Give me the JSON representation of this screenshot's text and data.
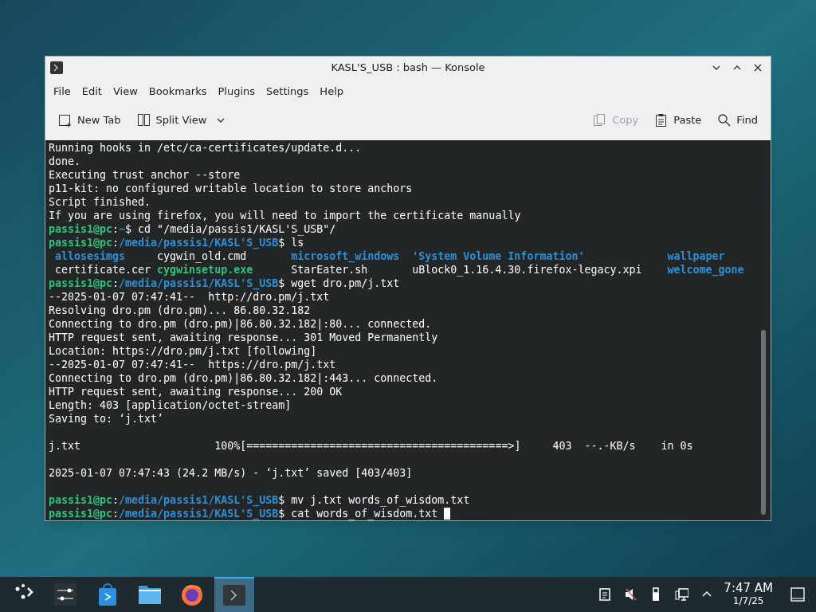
{
  "window": {
    "title": "KASL'S_USB : bash — Konsole"
  },
  "menu": [
    "File",
    "Edit",
    "View",
    "Bookmarks",
    "Plugins",
    "Settings",
    "Help"
  ],
  "toolbar": [
    {
      "kind": "new-tab",
      "label": "New Tab",
      "disabled": false
    },
    {
      "kind": "split-view",
      "label": "Split View",
      "disabled": false
    },
    {
      "kind": "copy",
      "label": "Copy",
      "disabled": true
    },
    {
      "kind": "paste",
      "label": "Paste",
      "disabled": false
    },
    {
      "kind": "find",
      "label": "Find",
      "disabled": false
    }
  ],
  "terminal": {
    "lines": [
      {
        "kind": "text",
        "segments": [
          {
            "kind": "plain",
            "text": "Running hooks in /etc/ca-certificates/update.d..."
          }
        ]
      },
      {
        "kind": "text",
        "segments": [
          {
            "kind": "plain",
            "text": "done."
          }
        ]
      },
      {
        "kind": "text",
        "segments": [
          {
            "kind": "plain",
            "text": "Executing trust anchor --store"
          }
        ]
      },
      {
        "kind": "text",
        "segments": [
          {
            "kind": "plain",
            "text": "p11-kit: no configured writable location to store anchors"
          }
        ]
      },
      {
        "kind": "text",
        "segments": [
          {
            "kind": "plain",
            "text": "Script finished."
          }
        ]
      },
      {
        "kind": "text",
        "segments": [
          {
            "kind": "plain",
            "text": "If you are using firefox, you will need to import the certificate manually"
          }
        ]
      },
      {
        "kind": "text",
        "segments": [
          {
            "kind": "user",
            "text": "passis1@pc"
          },
          {
            "kind": "plain",
            "text": ":"
          },
          {
            "kind": "path",
            "text": "~"
          },
          {
            "kind": "plain",
            "text": "$ cd \"/media/passis1/KASL'S_USB\"/"
          }
        ]
      },
      {
        "kind": "text",
        "segments": [
          {
            "kind": "user",
            "text": "passis1@pc"
          },
          {
            "kind": "plain",
            "text": ":"
          },
          {
            "kind": "path",
            "text": "/media/passis1/KASL'S_USB"
          },
          {
            "kind": "plain",
            "text": "$ ls"
          }
        ]
      },
      {
        "kind": "listing",
        "cells": [
          {
            "kind": "dir",
            "text": "allosesimgs"
          },
          {
            "kind": "plain",
            "text": "cygwin_old.cmd"
          },
          {
            "kind": "dir",
            "text": "microsoft_windows"
          },
          {
            "kind": "dir",
            "text": "'System Volume Information'"
          },
          {
            "kind": "dir",
            "text": "wallpaper"
          }
        ]
      },
      {
        "kind": "listing",
        "cells": [
          {
            "kind": "plain",
            "text": "certificate.cer"
          },
          {
            "kind": "exe",
            "text": "cygwinsetup.exe"
          },
          {
            "kind": "plain",
            "text": "StarEater.sh"
          },
          {
            "kind": "plain",
            "text": "uBlock0_1.16.4.30.firefox-legacy.xpi"
          },
          {
            "kind": "dir",
            "text": "welcome_gone"
          }
        ]
      },
      {
        "kind": "text",
        "segments": [
          {
            "kind": "user",
            "text": "passis1@pc"
          },
          {
            "kind": "plain",
            "text": ":"
          },
          {
            "kind": "path",
            "text": "/media/passis1/KASL'S_USB"
          },
          {
            "kind": "plain",
            "text": "$ wget dro.pm/j.txt"
          }
        ]
      },
      {
        "kind": "text",
        "segments": [
          {
            "kind": "plain",
            "text": "--2025-01-07 07:47:41--  http://dro.pm/j.txt"
          }
        ]
      },
      {
        "kind": "text",
        "segments": [
          {
            "kind": "plain",
            "text": "Resolving dro.pm (dro.pm)... 86.80.32.182"
          }
        ]
      },
      {
        "kind": "text",
        "segments": [
          {
            "kind": "plain",
            "text": "Connecting to dro.pm (dro.pm)|86.80.32.182|:80... connected."
          }
        ]
      },
      {
        "kind": "text",
        "segments": [
          {
            "kind": "plain",
            "text": "HTTP request sent, awaiting response... 301 Moved Permanently"
          }
        ]
      },
      {
        "kind": "text",
        "segments": [
          {
            "kind": "plain",
            "text": "Location: https://dro.pm/j.txt [following]"
          }
        ]
      },
      {
        "kind": "text",
        "segments": [
          {
            "kind": "plain",
            "text": "--2025-01-07 07:47:41--  https://dro.pm/j.txt"
          }
        ]
      },
      {
        "kind": "text",
        "segments": [
          {
            "kind": "plain",
            "text": "Connecting to dro.pm (dro.pm)|86.80.32.182|:443... connected."
          }
        ]
      },
      {
        "kind": "text",
        "segments": [
          {
            "kind": "plain",
            "text": "HTTP request sent, awaiting response... 200 OK"
          }
        ]
      },
      {
        "kind": "text",
        "segments": [
          {
            "kind": "plain",
            "text": "Length: 403 [application/octet-stream]"
          }
        ]
      },
      {
        "kind": "text",
        "segments": [
          {
            "kind": "plain",
            "text": "Saving to: ‘j.txt’"
          }
        ]
      },
      {
        "kind": "blank"
      },
      {
        "kind": "text",
        "segments": [
          {
            "kind": "plain",
            "text": "j.txt                     100%[=========================================>]     403  --.-KB/s    in 0s"
          }
        ]
      },
      {
        "kind": "blank"
      },
      {
        "kind": "text",
        "segments": [
          {
            "kind": "plain",
            "text": "2025-01-07 07:47:43 (24.2 MB/s) - ‘j.txt’ saved [403/403]"
          }
        ]
      },
      {
        "kind": "blank"
      },
      {
        "kind": "text",
        "segments": [
          {
            "kind": "user",
            "text": "passis1@pc"
          },
          {
            "kind": "plain",
            "text": ":"
          },
          {
            "kind": "path",
            "text": "/media/passis1/KASL'S_USB"
          },
          {
            "kind": "plain",
            "text": "$ mv j.txt words_of_wisdom.txt"
          }
        ]
      },
      {
        "kind": "text",
        "cursor": true,
        "segments": [
          {
            "kind": "user",
            "text": "passis1@pc"
          },
          {
            "kind": "plain",
            "text": ":"
          },
          {
            "kind": "path",
            "text": "/media/passis1/KASL'S_USB"
          },
          {
            "kind": "plain",
            "text": "$ cat words_of_wisdom.txt"
          }
        ]
      }
    ]
  },
  "taskbar": {
    "items": [
      {
        "kind": "launcher",
        "selected": false
      },
      {
        "kind": "settings",
        "selected": false
      },
      {
        "kind": "store",
        "selected": false
      },
      {
        "kind": "files",
        "selected": false
      },
      {
        "kind": "browser",
        "selected": false
      },
      {
        "kind": "terminal",
        "selected": true
      }
    ],
    "tray": [
      {
        "kind": "clipboard"
      },
      {
        "kind": "muted"
      },
      {
        "kind": "usb"
      },
      {
        "kind": "network"
      },
      {
        "kind": "expand"
      }
    ],
    "clock": {
      "time": "7:47 AM",
      "date": "1/7/25"
    }
  }
}
